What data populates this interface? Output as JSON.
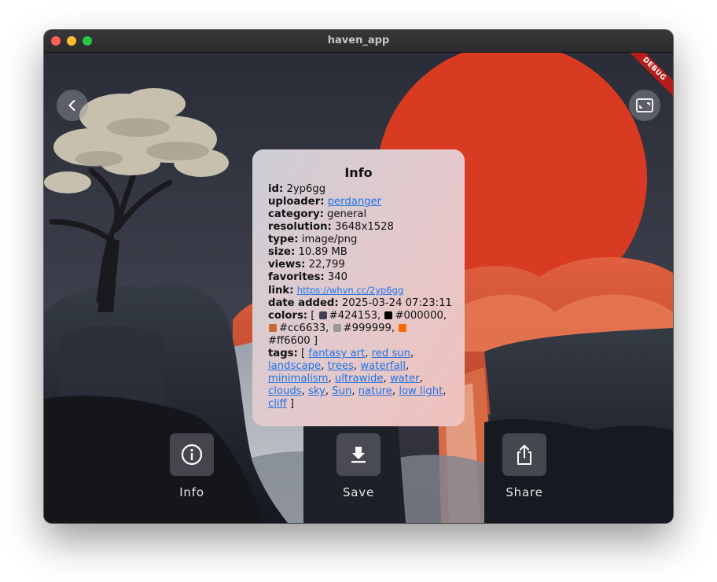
{
  "window": {
    "title": "haven_app"
  },
  "debug_banner": "DEBUG",
  "info": {
    "title": "Info",
    "fields": {
      "id": {
        "label": "id:",
        "value": "2yp6gg"
      },
      "uploader": {
        "label": "uploader:",
        "value": "perdanger"
      },
      "category": {
        "label": "category:",
        "value": "general"
      },
      "resolution": {
        "label": "resolution:",
        "value": "3648x1528"
      },
      "type": {
        "label": "type:",
        "value": "image/png"
      },
      "size": {
        "label": "size:",
        "value": "10.89 MB"
      },
      "views": {
        "label": "views:",
        "value": "22,799"
      },
      "favorites": {
        "label": "favorites:",
        "value": "340"
      },
      "link": {
        "label": "link:",
        "value": "https://whvn.cc/2yp6gg"
      },
      "date_added": {
        "label": "date added:",
        "value": "2025-03-24 07:23:11"
      }
    },
    "colors_label": "colors:",
    "open_bracket": "[",
    "close_bracket": "]",
    "colors": [
      {
        "hex": "#424153",
        "label": "#424153,"
      },
      {
        "hex": "#000000",
        "label": "#000000,"
      },
      {
        "hex": "#cc6633",
        "label": "#cc6633,"
      },
      {
        "hex": "#999999",
        "label": "#999999,"
      },
      {
        "hex": "#ff6600",
        "label": "#ff6600"
      }
    ],
    "tags_label": "tags:",
    "tags": [
      "fantasy art",
      "red sun",
      "landscape",
      "trees",
      "waterfall",
      "minimalism",
      "ultrawide",
      "water",
      "clouds",
      "sky",
      "Sun",
      "nature",
      "low light",
      "cliff"
    ],
    "separator": ","
  },
  "actions": {
    "info": {
      "label": "Info",
      "icon": "info-icon"
    },
    "save": {
      "label": "Save",
      "icon": "download-icon"
    },
    "share": {
      "label": "Share",
      "icon": "share-icon"
    }
  },
  "nav": {
    "back_icon": "chevron-left-icon",
    "fullscreen_icon": "fullscreen-icon"
  },
  "colors": {
    "link": "#1e73e6",
    "debug": "#b71c1c",
    "sun": "#d93a22"
  }
}
